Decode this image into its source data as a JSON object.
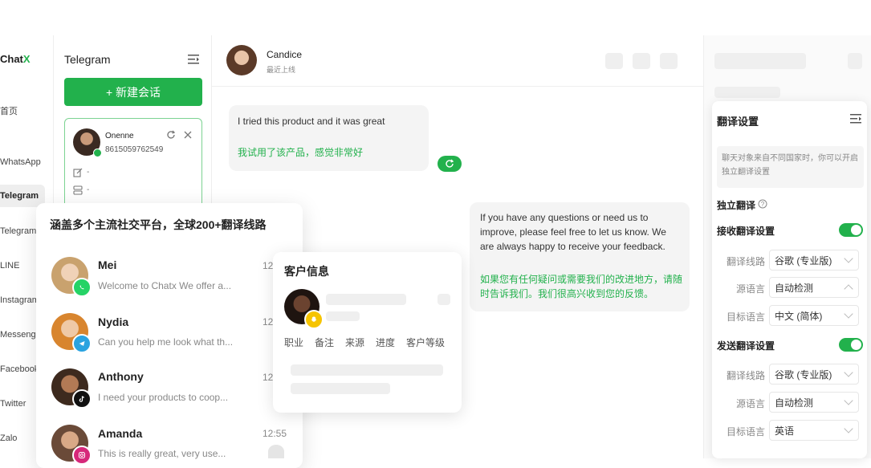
{
  "app": {
    "brand_prefix": "Chat",
    "brand_suffix": "X"
  },
  "nav": {
    "items": [
      {
        "label": "首页"
      },
      {
        "label": "WhatsApp"
      },
      {
        "label": "Telegram"
      },
      {
        "label": "TelegramK"
      },
      {
        "label": "LINE"
      },
      {
        "label": "Instagram"
      },
      {
        "label": "Messenger"
      },
      {
        "label": "Facebook"
      },
      {
        "label": "Twitter"
      },
      {
        "label": "Zalo"
      }
    ]
  },
  "sessions": {
    "title": "Telegram",
    "new_button": "+ 新建会话",
    "card": {
      "name": "Onenne",
      "phone": "8615059762549",
      "note": "-",
      "tag": "-"
    }
  },
  "chat": {
    "contact_name": "Candice",
    "contact_status": "最近上线",
    "messages": [
      {
        "original": "I tried this product and it was great",
        "translation": "我试用了该产品，感觉非常好"
      },
      {
        "original": "If you have any questions or need us to improve, please feel free to let us know. We are always happy to receive your feedback.",
        "translation": "如果您有任何疑问或需要我们的改进地方，请随时告诉我们。我们很高兴收到您的反馈。"
      }
    ]
  },
  "overlay": {
    "title": "涵盖多个主流社交平台，全球200+翻译线路",
    "rows": [
      {
        "name": "Mei",
        "message": "Welcome to Chatx We offer a...",
        "time": "12",
        "platform": "whatsapp-icon"
      },
      {
        "name": "Nydia",
        "message": "Can you help me look what th...",
        "time": "12",
        "platform": "telegram-icon"
      },
      {
        "name": "Anthony",
        "message": "I need your products to coop...",
        "time": "12",
        "platform": "tiktok-icon"
      },
      {
        "name": "Amanda",
        "message": "This is really great, very use...",
        "time": "12:55",
        "platform": "instagram-icon"
      }
    ]
  },
  "customer": {
    "title": "客户信息",
    "tabs": [
      "职业",
      "备注",
      "来源",
      "进度",
      "客户等级"
    ]
  },
  "settings": {
    "title": "翻译设置",
    "note": "聊天对象来自不同国家时，你可以开启独立翻译设置",
    "independent": "独立翻译",
    "receive": {
      "title": "接收翻译设置",
      "line_label": "翻译线路",
      "line_value": "谷歌 (专业版)",
      "source_label": "源语言",
      "source_value": "自动检测",
      "target_label": "目标语言",
      "target_value": "中文 (简体)"
    },
    "send": {
      "title": "发送翻译设置",
      "line_label": "翻译线路",
      "line_value": "谷歌 (专业版)",
      "source_label": "源语言",
      "source_value": "自动检测",
      "target_label": "目标语言",
      "target_value": "英语"
    }
  },
  "colors": {
    "accent": "#22b14c",
    "bubble": "#f4f4f4"
  }
}
